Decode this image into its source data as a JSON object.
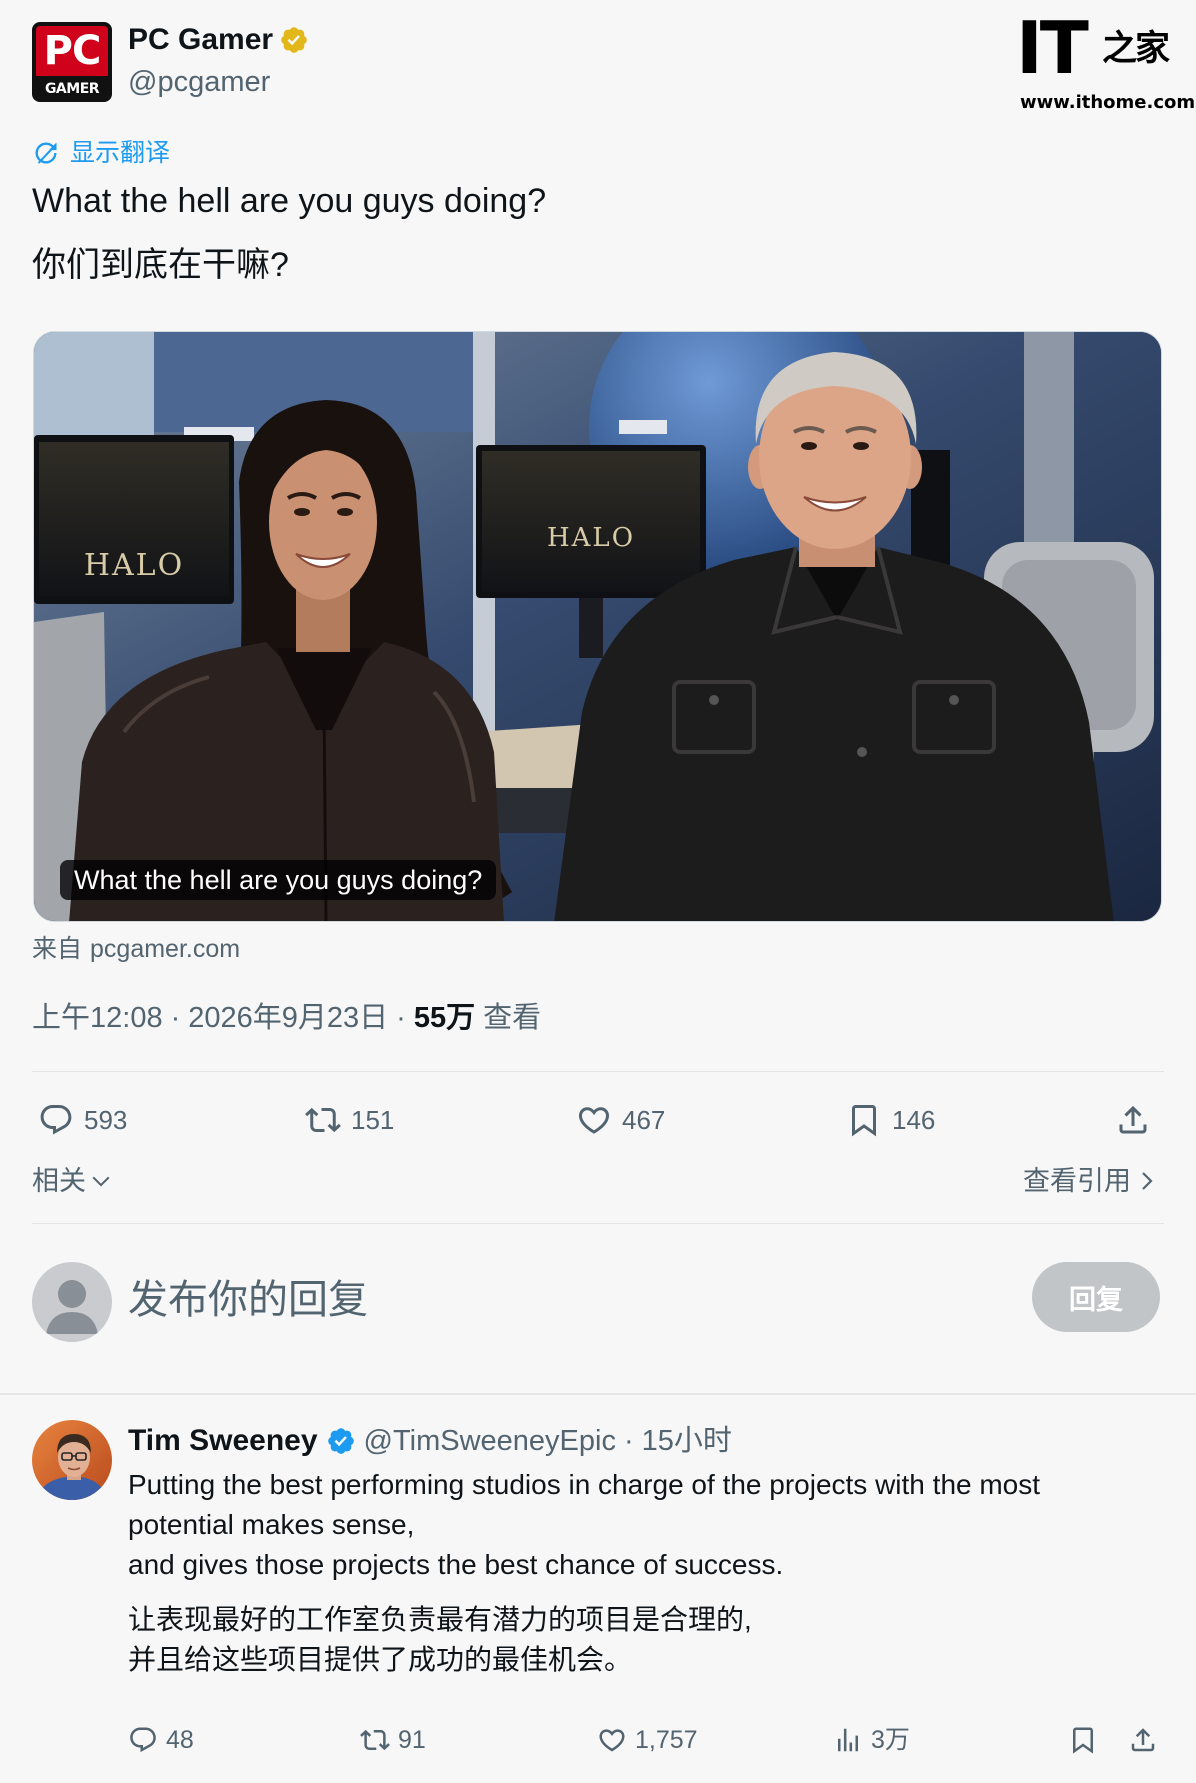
{
  "watermark": {
    "logo_main": "IT",
    "logo_sub": "之家",
    "url": "www.ithome.com"
  },
  "post": {
    "author": {
      "logo_top": "PC",
      "logo_bottom": "GAMER",
      "name": "PC Gamer",
      "handle": "@pcgamer",
      "badge_icon": "verified-gold-icon"
    },
    "translate_label": "显示翻译",
    "text_en": "What the hell are you guys doing?",
    "text_zh": "你们到底在干嘛?",
    "media": {
      "caption": "What the hell are you guys doing?",
      "monitor_logo": "HALO"
    },
    "source_prefix": "来自",
    "source_domain": "pcgamer.com",
    "meta": {
      "time": "上午12:08",
      "separator": "·",
      "date": "2026年9月23日",
      "views": "55万",
      "views_label": "查看"
    },
    "actions": {
      "replies": "593",
      "retweets": "151",
      "likes": "467",
      "bookmarks": "146"
    },
    "related_label": "相关",
    "quotes_label": "查看引用"
  },
  "composer": {
    "placeholder": "发布你的回复",
    "button_label": "回复"
  },
  "reply": {
    "author": {
      "name": "Tim Sweeney",
      "handle": "@TimSweeneyEpic",
      "separator": "·",
      "time": "15小时",
      "badge_icon": "verified-blue-icon"
    },
    "text_en": [
      "Putting the best performing studios in charge of the projects with the most",
      "potential makes sense,",
      "and gives those projects the best chance of success."
    ],
    "text_zh": [
      "让表现最好的工作室负责最有潜力的项目是合理的,",
      "并且给这些项目提供了成功的最佳机会。"
    ],
    "actions": {
      "replies": "48",
      "retweets": "91",
      "likes": "1,757",
      "views": "3万"
    }
  },
  "icons": {
    "reply": "reply-icon",
    "retweet": "retweet-icon",
    "like": "heart-icon",
    "bookmark": "bookmark-icon",
    "share": "share-icon",
    "views": "analytics-icon",
    "translate": "translate-icon"
  },
  "colors": {
    "text": "#0f1419",
    "secondary": "#536471",
    "accent": "#1d9bf0",
    "verified_gold": "#e2b719",
    "verified_blue": "#1d9bf0",
    "brand_red": "#d0021b"
  }
}
